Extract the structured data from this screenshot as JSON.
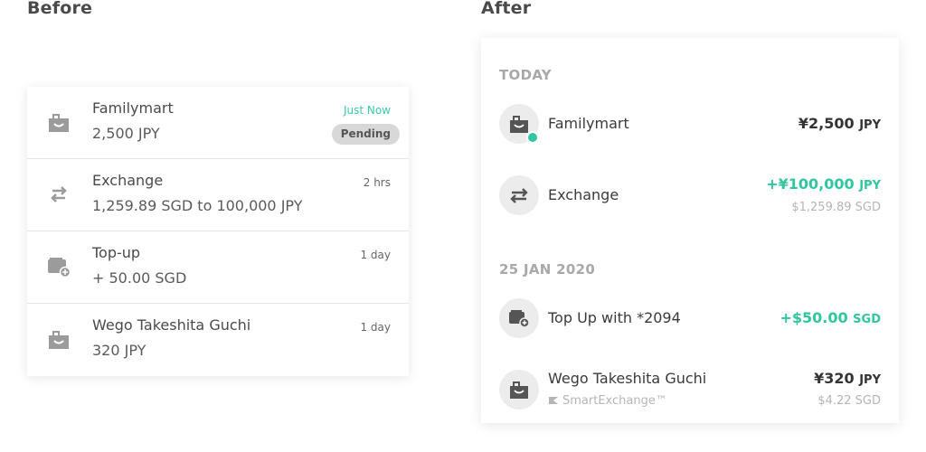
{
  "headings": {
    "before": "Before",
    "after": "After"
  },
  "before": {
    "rows": [
      {
        "icon": "shopping-bag-icon",
        "title": "Familymart",
        "sub": "2,500 JPY",
        "time": "Just Now",
        "badge": "Pending"
      },
      {
        "icon": "exchange-arrows-icon",
        "title": "Exchange",
        "sub": "1,259.89 SGD to 100,000 JPY",
        "time": "2 hrs"
      },
      {
        "icon": "wallet-add-icon",
        "title": "Top-up",
        "sub": "+ 50.00 SGD",
        "time": "1 day"
      },
      {
        "icon": "shopping-bag-icon",
        "title": "Wego Takeshita Guchi",
        "sub": "320 JPY",
        "time": "1 day"
      }
    ]
  },
  "after": {
    "groups": [
      "TODAY",
      "25 JAN 2020"
    ],
    "rows": [
      {
        "icon": "shopping-bag-icon",
        "status_icon": "clock-icon",
        "name": "Familymart",
        "amount": "¥2,500",
        "currency": "JPY"
      },
      {
        "icon": "exchange-arrows-icon",
        "name": "Exchange",
        "amount": "+¥100,000",
        "currency": "JPY",
        "sub_amount": "$1,259.89 SGD"
      },
      {
        "icon": "wallet-add-icon",
        "name": "Top Up with *2094",
        "amount": "+$50.00",
        "currency": "SGD"
      },
      {
        "icon": "shopping-bag-icon",
        "name": "Wego Takeshita Guchi",
        "note": "SmartExchange™",
        "amount": "¥320",
        "currency": "JPY",
        "sub_amount": "$4.22 SGD"
      }
    ]
  },
  "colors": {
    "accent_green": "#2fc6a0",
    "muted_gray": "#a8a8a8",
    "badge_gray": "#d8d8d8"
  }
}
